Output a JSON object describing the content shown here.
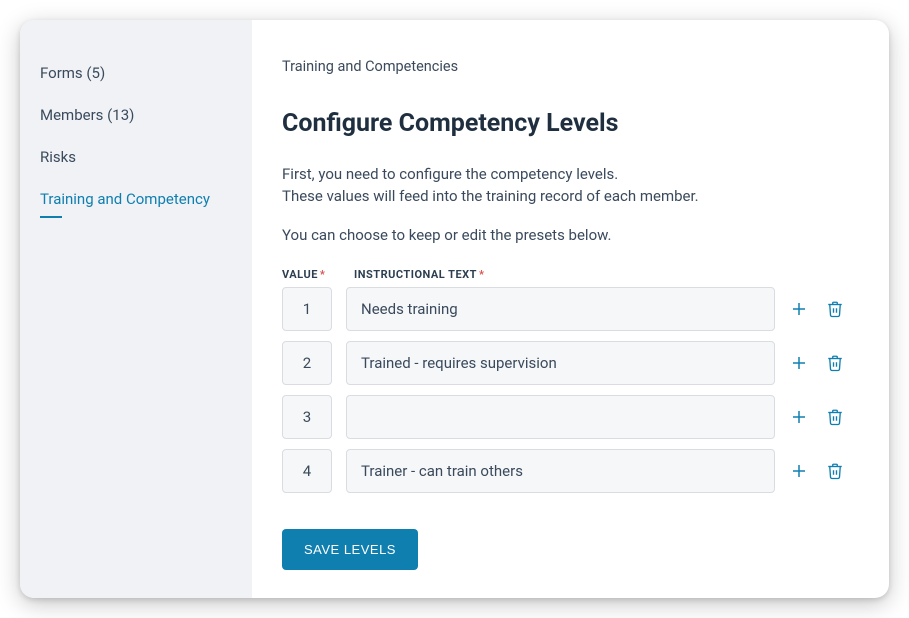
{
  "sidebar": {
    "items": [
      {
        "label": "Forms (5)",
        "active": false
      },
      {
        "label": "Members (13)",
        "active": false
      },
      {
        "label": "Risks",
        "active": false
      },
      {
        "label": "Training and Competency",
        "active": true
      }
    ]
  },
  "breadcrumb": "Training and Competencies",
  "title": "Configure Competency Levels",
  "intro_line1": "First, you need to configure the competency levels.",
  "intro_line2": "These values will feed into the training record of each member.",
  "hint": "You can choose to keep or edit the presets below.",
  "headers": {
    "value": "VALUE",
    "text": "INSTRUCTIONAL TEXT",
    "required_marker": "*"
  },
  "rows": [
    {
      "value": "1",
      "text": "Needs training"
    },
    {
      "value": "2",
      "text": "Trained - requires supervision"
    },
    {
      "value": "3",
      "text": ""
    },
    {
      "value": "4",
      "text": "Trainer - can train others"
    }
  ],
  "save_label": "SAVE LEVELS",
  "icons": {
    "add": "plus-icon",
    "delete": "trash-icon"
  },
  "colors": {
    "accent": "#0f7fb0",
    "required": "#d9534f",
    "sidebar_bg": "#f0f2f5"
  }
}
